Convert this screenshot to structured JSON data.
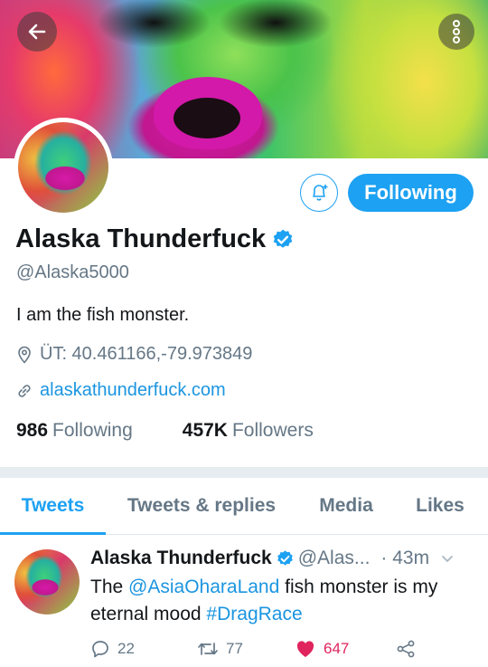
{
  "profile": {
    "name": "Alaska Thunderfuck",
    "handle": "@Alaska5000",
    "bio": "I am the fish monster.",
    "location": "ÜT: 40.461166,-79.973849",
    "website": "alaskathunderfuck.com",
    "following_count": "986",
    "following_label": "Following",
    "followers_count": "457K",
    "followers_label": "Followers",
    "follow_button_label": "Following"
  },
  "tabs": [
    {
      "label": "Tweets",
      "active": true
    },
    {
      "label": "Tweets & replies",
      "active": false
    },
    {
      "label": "Media",
      "active": false
    },
    {
      "label": "Likes",
      "active": false
    }
  ],
  "tweet": {
    "name": "Alaska Thunderfuck",
    "handle": "@Alas...",
    "time": "· 43m",
    "text_1": "The ",
    "mention": "@AsiaOharaLand",
    "text_2": " fish monster is my eternal mood ",
    "hashtag": "#DragRace",
    "replies": "22",
    "retweets": "77",
    "likes": "647"
  },
  "colors": {
    "accent": "#1da1f2",
    "like": "#e0245e",
    "secondary_text": "#657786"
  },
  "icons": [
    "back-arrow-icon",
    "more-vertical-icon",
    "bell-plus-icon",
    "verified-badge-icon",
    "location-pin-icon",
    "link-icon",
    "reply-icon",
    "retweet-icon",
    "heart-icon",
    "share-icon",
    "chevron-down-icon"
  ]
}
